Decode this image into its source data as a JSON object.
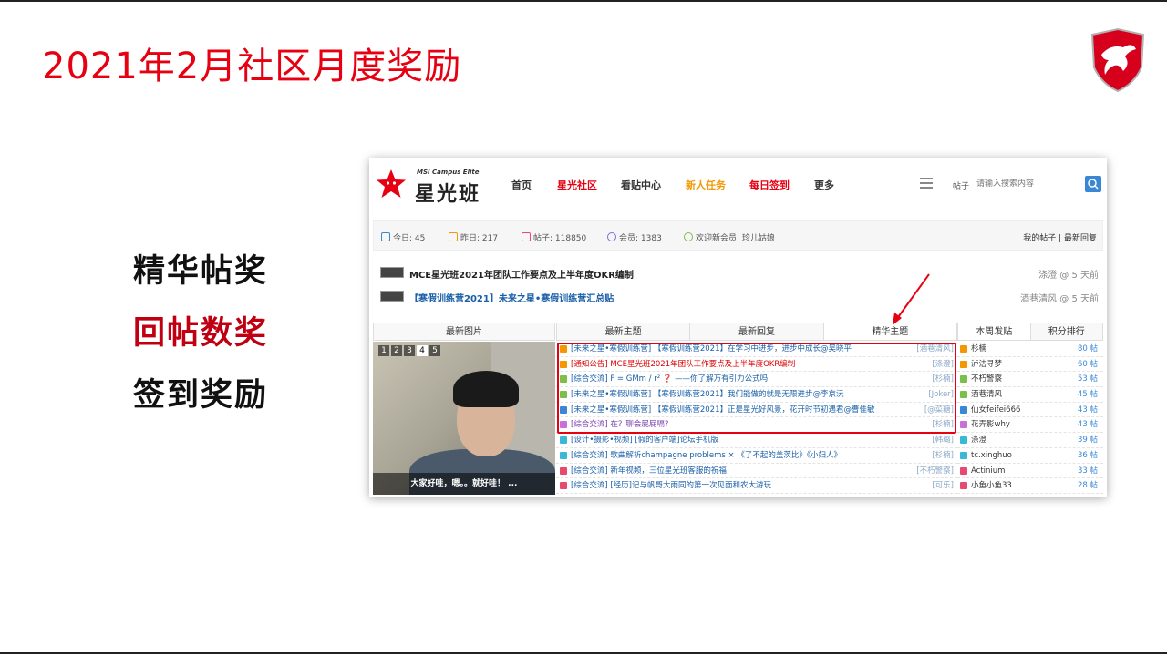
{
  "slide": {
    "title": "2021年2月社区月度奖励",
    "awards": [
      "精华帖奖",
      "回帖数奖",
      "签到奖励"
    ]
  },
  "forum": {
    "brand_sub": "MSI Campus Elite",
    "brand_name": "星光班",
    "nav": [
      "首页",
      "星光社区",
      "看贴中心",
      "新人任务",
      "每日签到",
      "更多"
    ],
    "search_label": "帖子",
    "search_placeholder": "请输入搜索内容",
    "stats": {
      "today": "今日: 45",
      "yesterday": "昨日: 217",
      "posts": "帖子: 118850",
      "members": "会员: 1383",
      "new_member": "欢迎新会员: 珍儿姑娘",
      "links": "我的帖子  |  最新回复"
    },
    "notices": [
      {
        "title": "MCE星光班2021年团队工作要点及上半年度OKR编制",
        "meta": "涤澄 @ 5 天前"
      },
      {
        "title": "【寒假训练营2021】未来之星•寒假训练营汇总贴",
        "meta": "酒巷清风 @ 5 天前"
      }
    ],
    "tabs_left": "最新图片",
    "tabs_mid": [
      "最新主题",
      "最新回复",
      "精华主题"
    ],
    "tabs_right": [
      "本周发贴",
      "积分排行"
    ],
    "photo": {
      "pager": [
        "1",
        "2",
        "3",
        "4",
        "5"
      ],
      "active_page": "4",
      "caption": "大家好哇，嗯。。就好哇！ ..."
    },
    "threads": [
      {
        "title": "[未来之星•寒假训练营] 【寒假训练营2021】在学习中进步，进步中成长@吴晓平",
        "author": "[酒巷清风]",
        "style": "blue",
        "color": "#f39800"
      },
      {
        "title": "[通知公告] MCE星光班2021年团队工作要点及上半年度OKR编制",
        "author": "[涤澄]",
        "style": "red",
        "color": "#f39800"
      },
      {
        "title": "[综合交流] F = GMm / r² ❓ ——你了解万有引力公式吗",
        "author": "[杉楠]",
        "style": "blue",
        "color": "#7cbf4a"
      },
      {
        "title": "[未来之星•寒假训练营] 【寒假训练营2021】我们能做的就是无限进步@李京沅",
        "author": "[Joker]",
        "style": "blue",
        "color": "#7cbf4a"
      },
      {
        "title": "[未来之星•寒假训练营] 【寒假训练营2021】正是星光好风景，花开时节初遇君@曹佳敏",
        "author": "[@菜糖]",
        "style": "blue",
        "color": "#3a87d6"
      },
      {
        "title": "[综合交流] 在？聊会屁屁嗝?",
        "author": "[杉楠]",
        "style": "purple",
        "color": "#c86fd8"
      },
      {
        "title": "[设计•摄影•视频] [假的客户端]论坛手机版",
        "author": "[韩璐]",
        "style": "blue",
        "color": "#3ab8d6"
      },
      {
        "title": "[综合交流] 歌曲解析champagne problems × 《了不起的盖茨比》《小妇人》",
        "author": "[杉楠]",
        "style": "blue",
        "color": "#3ab8d6"
      },
      {
        "title": "[综合交流] 新年视频，三位星光班客服的祝福",
        "author": "[不朽警察]",
        "style": "blue",
        "color": "#e64a6e"
      },
      {
        "title": "[综合交流] [经历]记与帆哥大雨同的第一次见面和农大游玩",
        "author": "[可乐]",
        "style": "blue",
        "color": "#e64a6e"
      }
    ],
    "ranks": [
      {
        "name": "杉楠",
        "count": "80 帖",
        "color": "#f39800"
      },
      {
        "name": "泸沽寻梦",
        "count": "60 帖",
        "color": "#f39800"
      },
      {
        "name": "不朽警察",
        "count": "53 帖",
        "color": "#7cbf4a"
      },
      {
        "name": "酒巷清风",
        "count": "45 帖",
        "color": "#7cbf4a"
      },
      {
        "name": "仙女feifei666",
        "count": "43 帖",
        "color": "#3a87d6"
      },
      {
        "name": "花弄影why",
        "count": "43 帖",
        "color": "#c86fd8"
      },
      {
        "name": "涤澄",
        "count": "39 帖",
        "color": "#3ab8d6"
      },
      {
        "name": "tc.xinghuo",
        "count": "36 帖",
        "color": "#3ab8d6"
      },
      {
        "name": "Actinium",
        "count": "33 帖",
        "color": "#e64a6e"
      },
      {
        "name": "小鱼小鱼33",
        "count": "28 帖",
        "color": "#e64a6e"
      }
    ]
  }
}
